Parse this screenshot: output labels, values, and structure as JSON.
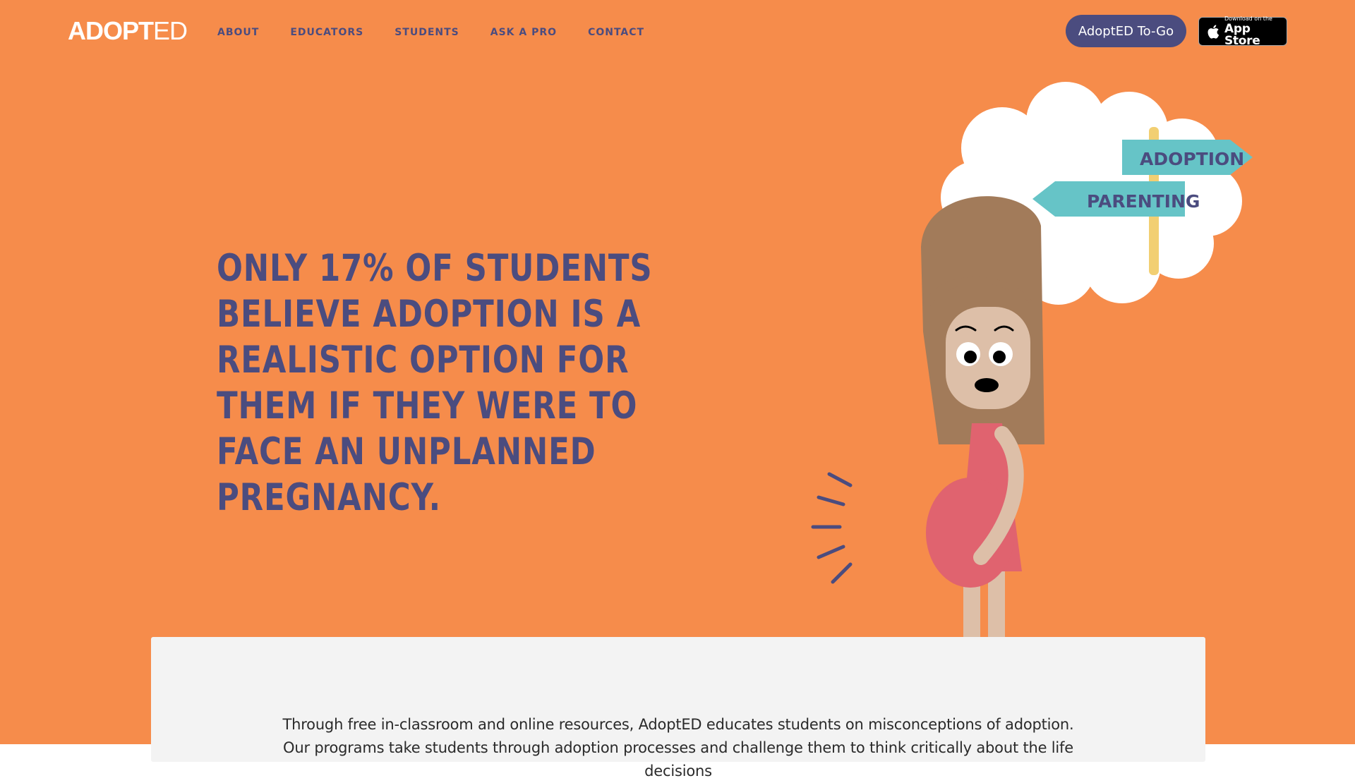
{
  "header": {
    "logo_bold": "ADOPT",
    "logo_thin": "ED",
    "nav": [
      {
        "label": "ABOUT"
      },
      {
        "label": "EDUCATORS"
      },
      {
        "label": "STUDENTS"
      },
      {
        "label": "ASK A PRO"
      },
      {
        "label": "CONTACT"
      }
    ],
    "togo_button": "AdoptED To-Go",
    "appstore": {
      "small": "Download on the",
      "big": "App Store",
      "icon": "apple-icon"
    }
  },
  "hero": {
    "headline": "ONLY 17% OF STUDENTS BELIEVE ADOPTION IS A REALISTIC OPTION FOR THEM IF THEY WERE TO FACE AN UNPLANNED PREGNANCY.",
    "sign_adoption": "ADOPTION",
    "sign_parenting": "PARENTING"
  },
  "intro": {
    "text": "Through free in-classroom and online resources, AdoptED educates students on misconceptions of adoption. Our programs take students through adoption processes and challenge them to think critically about the life decisions"
  },
  "colors": {
    "hero_bg": "#f68c4b",
    "navy": "#4b4c7f",
    "sign_teal": "#66c4c7",
    "dress_pink": "#e0636f",
    "hair_brown": "#a27b5a"
  }
}
